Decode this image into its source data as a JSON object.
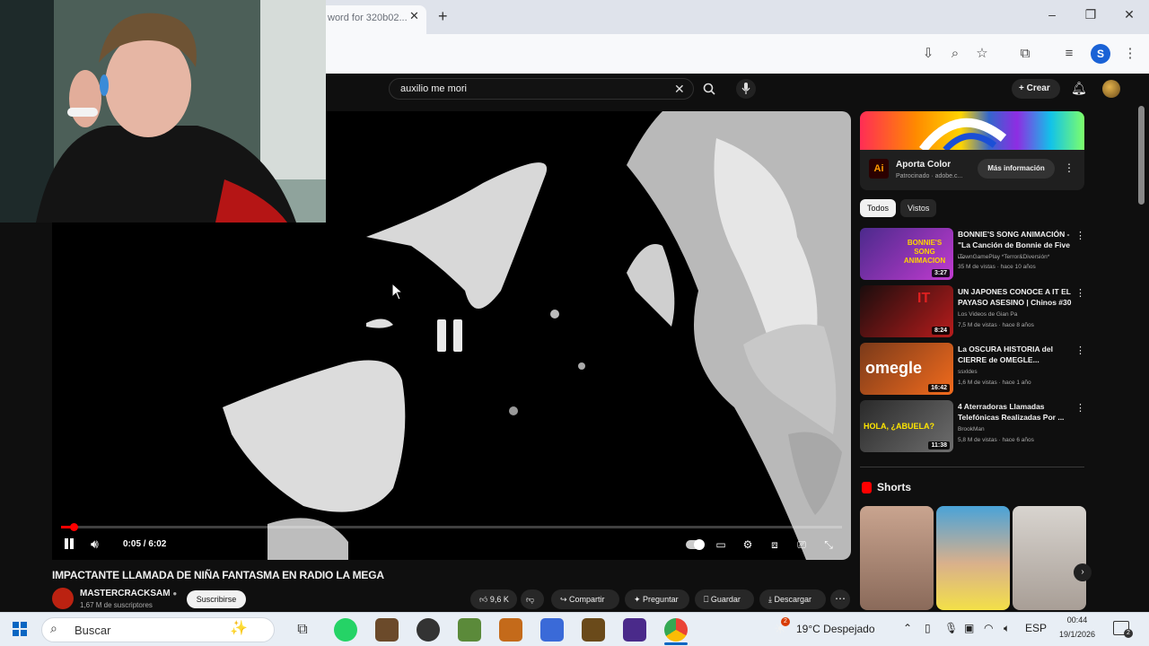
{
  "browser": {
    "tab_title": "word for 320b02...",
    "controls": {
      "minimize": "–",
      "maximize": "❐",
      "close": "✕"
    },
    "profile_initial": "S"
  },
  "youtube": {
    "search": {
      "value": "auxilio me mori"
    },
    "create_label": "Crear"
  },
  "player": {
    "time": "0:05 / 6:02",
    "progress": 0.014
  },
  "video": {
    "title": "IMPACTANTE LLAMADA DE NIÑA FANTASMA EN RADIO LA MEGA",
    "channel": "MASTERCRACKSAM",
    "subscribers": "1,67 M de suscriptores",
    "subscribe_label": "Suscribirse",
    "likes": "9,6 K",
    "share_label": "Compartir",
    "ask_label": "Preguntar",
    "save_label": "Guardar",
    "download_label": "Descargar"
  },
  "ad": {
    "logo": "Ai",
    "title": "Aporta Color",
    "sponsored": "Patrocinado · adobe.c...",
    "cta": "Más información"
  },
  "chips": [
    "Todos",
    "Vistos"
  ],
  "recommendations": [
    {
      "title": "BONNIE'S SONG ANIMACIÓN - \"La Canción de Bonnie de Five ...",
      "channel": "iTownGamePlay *Terror&Diversión*",
      "meta": "35 M de vistas · hace 10 años",
      "duration": "3:27",
      "thumb_text": "BONNIE'S SONG ANIMACION",
      "colors": [
        "#4b2a8c",
        "#c13bd0"
      ]
    },
    {
      "title": "UN JAPONES CONOCE A IT EL PAYASO ASESINO | Chinos #30",
      "channel": "Los Videos de Gian Pa",
      "meta": "7,5 M de vistas · hace 8 años",
      "duration": "8:24",
      "thumb_text": "IT",
      "colors": [
        "#1a0d0d",
        "#b81c1c"
      ]
    },
    {
      "title": "La OSCURA HISTORIA del CIERRE de OMEGLE...",
      "channel": "ssxldes",
      "meta": "1,6 M de vistas · hace 1 año",
      "duration": "16:42",
      "thumb_text": "omegle",
      "colors": [
        "#7a3a1a",
        "#f26b1d"
      ]
    },
    {
      "title": "4 Aterradoras Llamadas Telefónicas Realizadas Por ...",
      "channel": "BrookMan",
      "meta": "5,8 M de vistas · hace 6 años",
      "duration": "11:38",
      "thumb_text": "HOLA, ¿ABUELA?",
      "colors": [
        "#2a2a2a",
        "#6e6e6e"
      ]
    }
  ],
  "shorts_label": "Shorts",
  "taskbar": {
    "search_placeholder": "Buscar",
    "weather_badge": "2",
    "temperature": "19°C",
    "weather": "Despejado",
    "language": "ESP",
    "time": "00:44",
    "date": "19/1/2026",
    "notifications": "2"
  }
}
